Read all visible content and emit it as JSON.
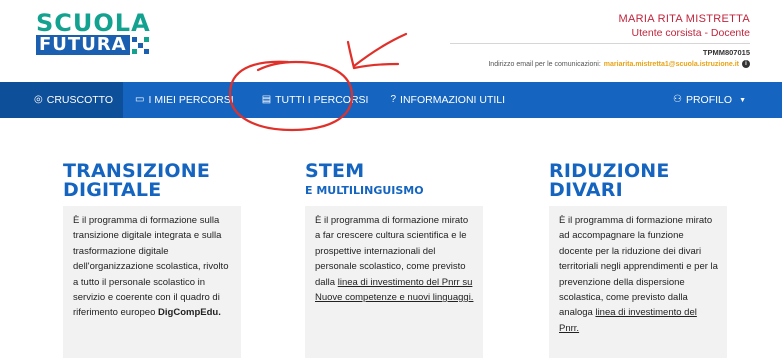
{
  "brand": {
    "logo_line1": "SCUOLA",
    "logo_line2": "FUTURA"
  },
  "user": {
    "name": "MARIA RITA MISTRETTA",
    "role": "Utente corsista - Docente",
    "code": "TPMM807015",
    "email_label": "Indirizzo email per le comunicazioni:",
    "email": "mariarita.mistretta1@scuola.istruzione.it"
  },
  "nav": {
    "items": [
      {
        "icon": "dashboard-icon",
        "label": "CRUSCOTTO"
      },
      {
        "icon": "monitor-icon",
        "label": "I MIEI PERCORSI"
      },
      {
        "icon": "list-icon",
        "label": "TUTTI I PERCORSI"
      },
      {
        "icon": "question-icon",
        "label": "INFORMAZIONI UTILI"
      }
    ],
    "profile_label": "PROFILO"
  },
  "cards": [
    {
      "title_l1": "TRANSIZIONE",
      "title_l2": "DIGITALE",
      "body_pre": "È il programma di formazione sulla transizione digitale integrata e sulla trasformazione digitale dell'organizzazione scolastica, rivolto a tutto il personale scolastico in servizio e coerente con il quadro di riferimento europeo",
      "body_bold": "DigCompEdu."
    },
    {
      "title_l1": "STEM",
      "subtitle": "E MULTILINGUISMO",
      "body_pre": "È il programma di formazione mirato a far crescere cultura scientifica e le prospettive internazionali del personale scolastico, come previsto dalla",
      "body_link": "linea di investimento del Pnrr su Nuove competenze e nuovi linguaggi."
    },
    {
      "title_l1": "RIDUZIONE",
      "title_l2": "DIVARI",
      "body_pre": "È il programma di formazione mirato ad accompagnare la funzione docente per la riduzione dei divari territoriali negli apprendimenti e per la prevenzione della dispersione scolastica, come previsto dalla analoga",
      "body_link": "linea di investimento del Pnrr."
    }
  ],
  "colors": {
    "navbar": "#1565c0",
    "navbar_active": "#0e4f9a",
    "brand_green": "#13a28f",
    "brand_blue": "#1a5fb0",
    "user_text": "#c0243c",
    "email": "#e8a317",
    "annotation_red": "#e0302a"
  }
}
